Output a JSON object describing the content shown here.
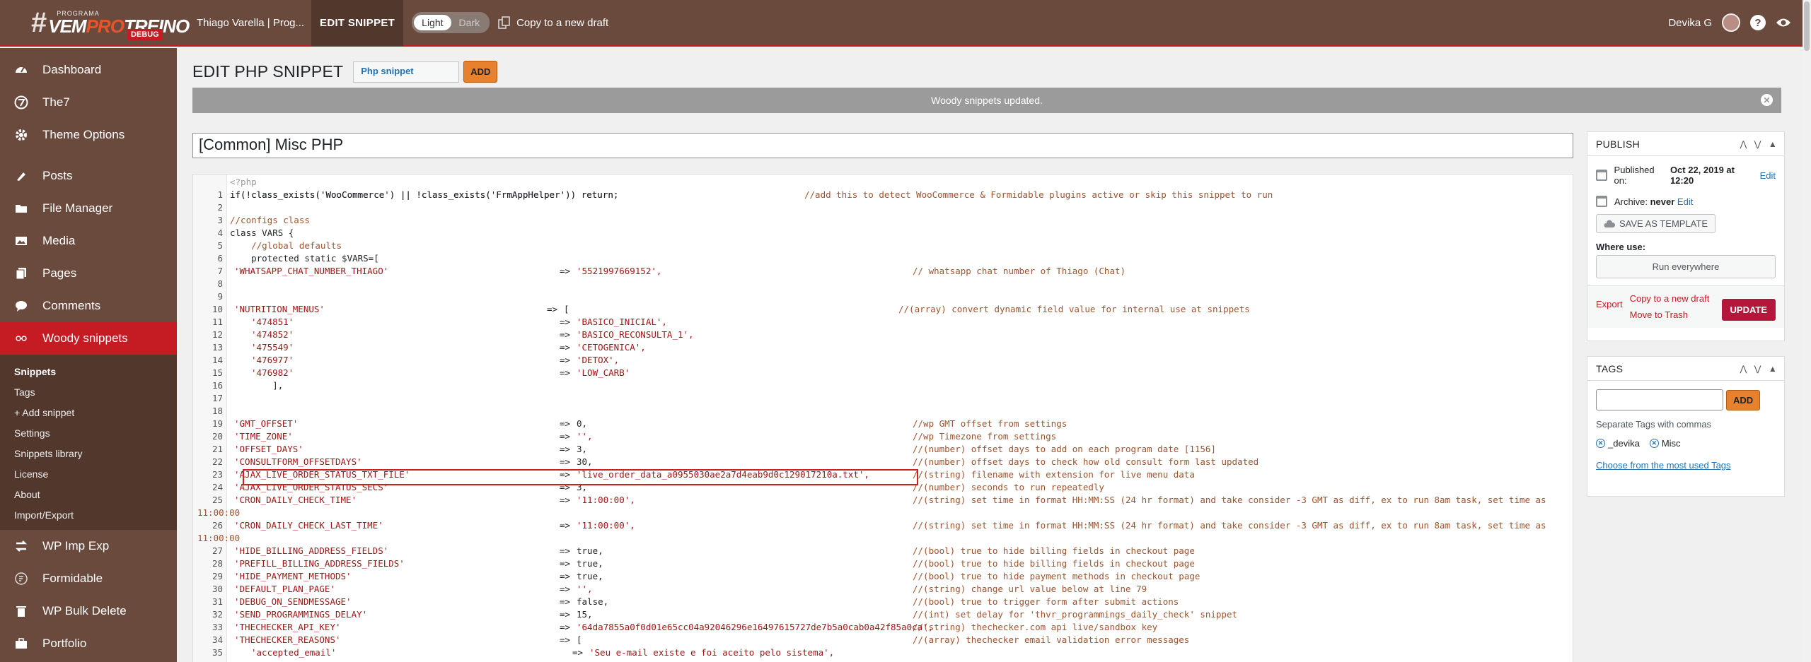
{
  "topbar": {
    "logo_small": "PROGRAMA",
    "logo_hash": "#",
    "logo_vem": "VEM",
    "logo_pro": "PRO",
    "logo_treino": "TREINO",
    "debug_badge": "DEBUG",
    "site_name": "Thiago Varella | Prog...",
    "edit_snippet": "EDIT SNIPPET",
    "theme_light": "Light",
    "theme_dark": "Dark",
    "copy_draft": "Copy to a new draft",
    "user_name": "Devika G",
    "help": "?"
  },
  "sidebar": {
    "items": [
      {
        "label": "Dashboard",
        "icon": "dashboard-icon"
      },
      {
        "label": "The7",
        "icon": "the7-icon"
      },
      {
        "label": "Theme Options",
        "icon": "gear-icon"
      },
      {
        "label": "Posts",
        "icon": "pin-icon"
      },
      {
        "label": "File Manager",
        "icon": "folder-icon"
      },
      {
        "label": "Media",
        "icon": "media-icon"
      },
      {
        "label": "Pages",
        "icon": "pages-icon"
      },
      {
        "label": "Comments",
        "icon": "comments-icon"
      },
      {
        "label": "Woody snippets",
        "icon": "woody-icon"
      }
    ],
    "submenu": [
      "Snippets",
      "Tags",
      "+ Add snippet",
      "Settings",
      "Snippets library",
      "License",
      "About",
      "Import/Export"
    ],
    "items_after": [
      {
        "label": "WP Imp Exp",
        "icon": "import-export-icon"
      },
      {
        "label": "Formidable",
        "icon": "formidable-icon"
      },
      {
        "label": "WP Bulk Delete",
        "icon": "trash-icon"
      },
      {
        "label": "Portfolio",
        "icon": "portfolio-icon"
      }
    ]
  },
  "main": {
    "page_title": "EDIT PHP SNIPPET",
    "snippet_type": "Php snippet",
    "add_label": "ADD",
    "notice": "Woody snippets updated.",
    "snippet_title": "[Common] Misc PHP"
  },
  "editor": {
    "header": "<?php",
    "lines": [
      {
        "n": "1",
        "code": "if(!class_exists('WooCommerce') || !class_exists('FrmAppHelper')) return;",
        "comment": "//add this to detect WooCommerce & Formidable plugins active or skip this snippet to run"
      },
      {
        "n": "2",
        "code": ""
      },
      {
        "n": "3",
        "code": "//configs class"
      },
      {
        "n": "4",
        "code": "class VARS {"
      },
      {
        "n": "5",
        "code": "    //global defaults"
      },
      {
        "n": "6",
        "code": "    protected static $VARS=["
      },
      {
        "n": "7",
        "key": "'WHATSAPP_CHAT_NUMBER_THIAGO'",
        "val": "'5521997669152',",
        "comment": "// whatsapp chat number of Thiago (Chat)"
      },
      {
        "n": "8",
        "code": ""
      },
      {
        "n": "9",
        "code": ""
      },
      {
        "n": "10",
        "key": "'NUTRITION_MENUS'",
        "val": "[",
        "comment": "//(array) convert dynamic field value for internal use at snippets",
        "short": true
      },
      {
        "n": "11",
        "key": "'474851'",
        "val": "'BASICO_INICIAL',",
        "indent": true
      },
      {
        "n": "12",
        "key": "'474852'",
        "val": "'BASICO_RECONSULTA_1',",
        "indent": true
      },
      {
        "n": "13",
        "key": "'475549'",
        "val": "'CETOGENICA',",
        "indent": true
      },
      {
        "n": "14",
        "key": "'476977'",
        "val": "'DETOX',",
        "indent": true
      },
      {
        "n": "15",
        "key": "'476982'",
        "val": "'LOW_CARB'",
        "indent": true
      },
      {
        "n": "16",
        "code": "        ],"
      },
      {
        "n": "17",
        "code": ""
      },
      {
        "n": "18",
        "code": ""
      },
      {
        "n": "19",
        "key": "'GMT_OFFSET'",
        "val": "0,",
        "comment": "//wp GMT offset from settings"
      },
      {
        "n": "20",
        "key": "'TIME_ZONE'",
        "val": "'',",
        "comment": "//wp Timezone from settings"
      },
      {
        "n": "21",
        "key": "'OFFSET_DAYS'",
        "val": "3,",
        "comment": "//(number) offset days to add on each program date [1156]"
      },
      {
        "n": "22",
        "key": "'CONSULTFORM_OFFSETDAYS'",
        "val": "30,",
        "comment": "//(number) offset days to check how old consult form last updated"
      },
      {
        "n": "23",
        "key": "'AJAX_LIVE_ORDER_STATUS_TXT_FILE'",
        "val": "'live_order_data_a0955030ae2a7d4eab9d0c129017210a.txt',",
        "comment": "//(string) filename with extension for live menu data"
      },
      {
        "n": "24",
        "key": "'AJAX_LIVE_ORDER_STATUS_SECS'",
        "val": "3,",
        "comment": "//(number) seconds to run repeatedly"
      },
      {
        "n": "25",
        "key": "'CRON_DAILY_CHECK_TIME'",
        "val": "'11:00:00',",
        "comment": "//(string) set time in format HH:MM:SS (24 hr format) and take consider -3 GMT as diff, ex to run 8am task, set time as",
        "wrap": "11:00:00"
      },
      {
        "n": "26",
        "key": "'CRON_DAILY_CHECK_LAST_TIME'",
        "val": "'11:00:00',",
        "comment": "//(string) set time in format HH:MM:SS (24 hr format) and take consider -3 GMT as diff, ex to run 8am task, set time as",
        "wrap": "11:00:00"
      },
      {
        "n": "27",
        "key": "'HIDE_BILLING_ADDRESS_FIELDS'",
        "val": "true,",
        "comment": "//(bool) true to hide billing fields in checkout page"
      },
      {
        "n": "28",
        "key": "'PREFILL_BILLING_ADDRESS_FIELDS'",
        "val": "true,",
        "comment": "//(bool) true to hide billing fields in checkout page"
      },
      {
        "n": "29",
        "key": "'HIDE_PAYMENT_METHODS'",
        "val": "true,",
        "comment": "//(bool) true to hide payment methods in checkout page"
      },
      {
        "n": "30",
        "key": "'DEFAULT_PLAN_PAGE'",
        "val": "'',",
        "comment": "//(string) change url value below at line 79"
      },
      {
        "n": "31",
        "key": "'DEBUG_ON_SENDMESSAGE'",
        "val": "false,",
        "comment": "//(bool) true to trigger form after submit actions"
      },
      {
        "n": "32",
        "key": "'SEND_PROGRAMMINGS_DELAY'",
        "val": "15,",
        "comment": "//(int) set delay for 'thvr_programmings_daily_check' snippet"
      },
      {
        "n": "33",
        "key": "'THECHECKER_API_KEY'",
        "val": "'64da7855a0f0d01e65cc04a92046296e16497615727de7b5a0cab0a42f85a0ca',",
        "comment": "//(string) thechecker.com api live/sandbox key"
      },
      {
        "n": "34",
        "key": "'THECHECKER_REASONS'",
        "val": "[",
        "comment": "//(array) thechecker email validation error messages"
      },
      {
        "n": "35",
        "key": "'accepted_email'",
        "val": "'Seu e-mail existe e foi aceito pelo sistema',",
        "indent": true,
        "arrow_offset": true
      }
    ]
  },
  "publish": {
    "title": "PUBLISH",
    "published_label": "Published on:",
    "published_date": "Oct 22, 2019 at 12:20",
    "edit": "Edit",
    "archive_label": "Archive:",
    "archive_value": "never",
    "save_template": "SAVE AS TEMPLATE",
    "where_use": "Where use:",
    "run_everywhere": "Run everywhere",
    "export": "Export",
    "copy_draft": "Copy to a new draft",
    "move_trash": "Move to Trash",
    "update": "UPDATE"
  },
  "tags": {
    "title": "TAGS",
    "add": "ADD",
    "help": "Separate Tags with commas",
    "items": [
      "_devika",
      "Misc"
    ],
    "choose": "Choose from the most used Tags"
  },
  "colors": {
    "brand": "#6b4a3e",
    "accent": "#c51b23",
    "orange": "#e8812d"
  }
}
